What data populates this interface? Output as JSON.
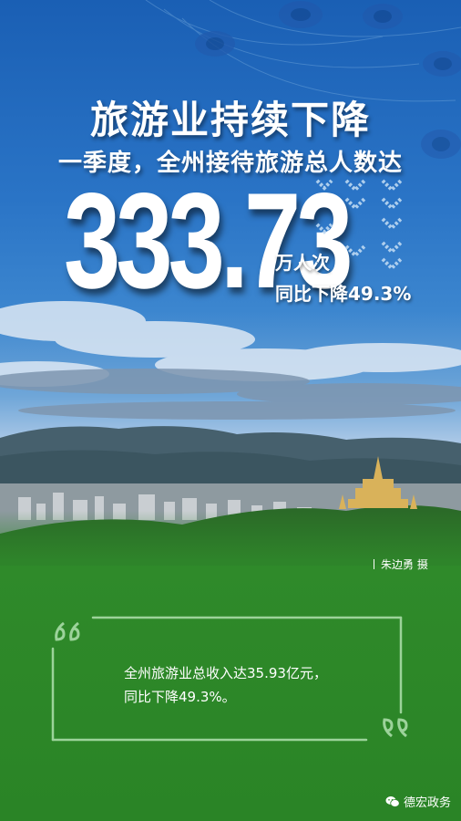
{
  "poster": {
    "headline": "旅游业持续下降",
    "subheadline": "一季度，全州接待旅游总人数达",
    "big_number": "333.73",
    "unit": "万人次",
    "yoy_change": "同比下降49.3%",
    "photo_credit": "朱边勇  摄",
    "quote_line1": "全州旅游业总收入达35.93亿元，",
    "quote_line2": "同比下降49.3%。",
    "brand": "德宏政务"
  },
  "icons": {
    "decline_arrows": "down-chevron-arrows-icon",
    "quote_open": "open-quote-icon",
    "quote_close": "close-quote-icon",
    "brand_logo": "wechat-icon"
  },
  "colors": {
    "sky_top": "#1a5fb4",
    "green_panel": "#2f8a2a",
    "text": "#ffffff"
  }
}
